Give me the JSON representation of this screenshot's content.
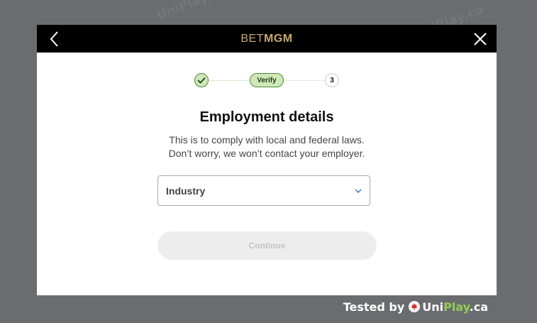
{
  "watermark": {
    "text": "UniPlay.ca"
  },
  "header": {
    "logo_prefix": "BET",
    "logo_suffix": "MGM",
    "back_icon": "chevron-left-icon",
    "close_icon": "close-icon",
    "background": "#000000",
    "logo_color": "#c9a86a"
  },
  "stepper": {
    "step1": {
      "state": "completed",
      "icon": "check-icon"
    },
    "step2": {
      "label": "Verify",
      "state": "current"
    },
    "step3": {
      "label": "3",
      "state": "upcoming"
    },
    "active_color": "#cfe8b8"
  },
  "form": {
    "title": "Employment details",
    "subtitle_line1": "This is to comply with local and federal laws.",
    "subtitle_line2": "Don’t worry, we won’t contact your employer.",
    "industry_select": {
      "label": "Industry",
      "icon": "chevron-down-icon"
    },
    "continue_label": "Continue",
    "continue_disabled": true
  },
  "footer": {
    "tested_by": "Tested by",
    "brand_uni": "Uni",
    "brand_play": "Play",
    "brand_tld": ".ca",
    "flag_icon": "maple-leaf-icon"
  }
}
